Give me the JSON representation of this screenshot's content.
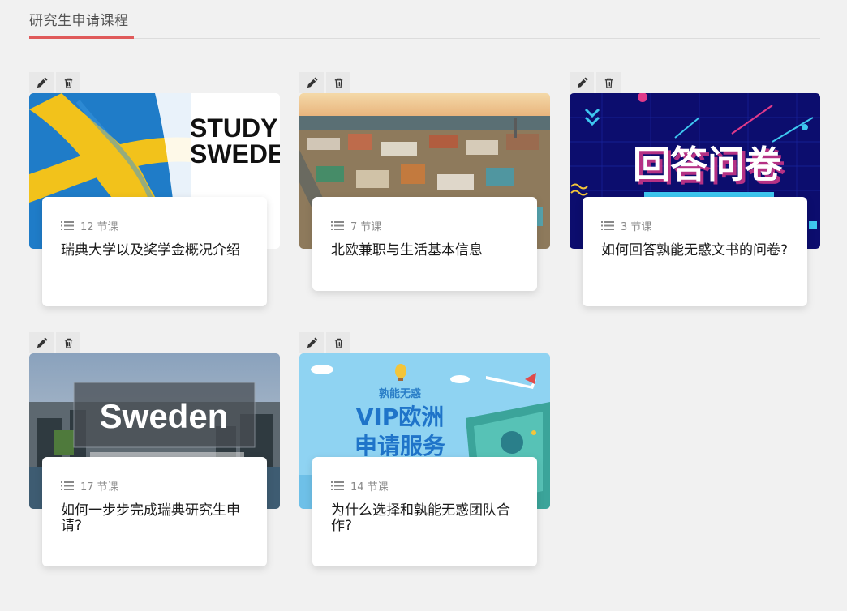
{
  "header": {
    "tab_title": "研究生申请课程"
  },
  "courses": [
    {
      "lessons": "12 节课",
      "title": "瑞典大学以及奖学金概况介绍",
      "thumb_text": [
        "STUDY",
        "SWEDE"
      ]
    },
    {
      "lessons": "7 节课",
      "title": "北欧兼职与生活基本信息"
    },
    {
      "lessons": "3 节课",
      "title": "如何回答孰能无惑文书的问卷?",
      "thumb_text": [
        "回答问卷"
      ]
    },
    {
      "lessons": "17 节课",
      "title": "如何一步步完成瑞典研究生申请?",
      "thumb_text": [
        "Sweden"
      ]
    },
    {
      "lessons": "14 节课",
      "title": "为什么选择和孰能无惑团队合作?",
      "thumb_text": [
        "孰能无惑",
        "VIP欧洲",
        "申请服务"
      ]
    }
  ],
  "icons": {
    "edit": "pencil-icon",
    "delete": "trash-icon",
    "lessons": "list-icon"
  },
  "colors": {
    "accent": "#e05a5a"
  }
}
